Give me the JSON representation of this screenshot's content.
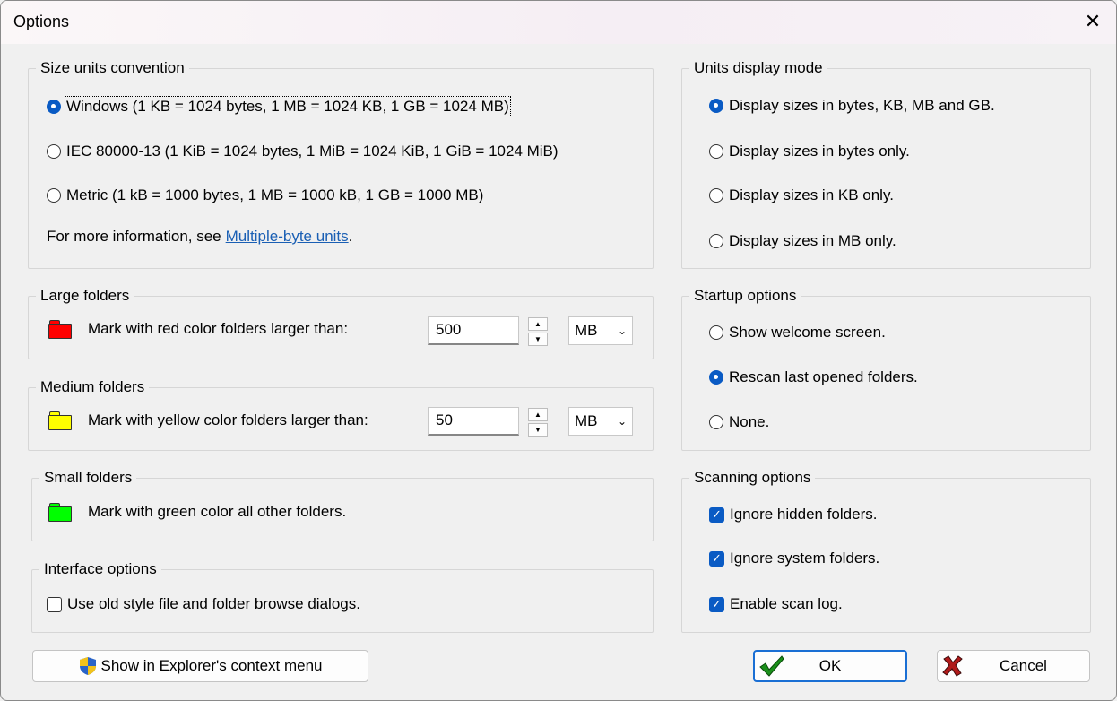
{
  "window": {
    "title": "Options",
    "close_glyph": "✕"
  },
  "size_units": {
    "title": "Size units convention",
    "opt_windows": "Windows (1 KB = 1024 bytes, 1 MB = 1024 KB, 1 GB = 1024 MB)",
    "opt_iec": "IEC 80000-13 (1 KiB = 1024 bytes, 1 MiB = 1024 KiB, 1 GiB = 1024 MiB)",
    "opt_metric": "Metric (1 kB = 1000 bytes, 1 MB = 1000 kB, 1 GB = 1000 MB)",
    "info_prefix": "For more information, see ",
    "info_link": "Multiple-byte units",
    "info_suffix": "."
  },
  "large_folders": {
    "title": "Large folders",
    "label": "Mark with red color folders larger than:",
    "value": "500",
    "unit": "MB",
    "color": "#ff0000"
  },
  "medium_folders": {
    "title": "Medium folders",
    "label": "Mark with yellow color folders larger than:",
    "value": "50",
    "unit": "MB",
    "color": "#ffff00"
  },
  "small_folders": {
    "title": "Small folders",
    "label": "Mark with green color all other folders.",
    "color": "#00ff00"
  },
  "interface_options": {
    "title": "Interface options",
    "old_dialogs": "Use old style file and folder browse dialogs."
  },
  "units_display": {
    "title": "Units display mode",
    "opt_all": "Display sizes in bytes, KB, MB and GB.",
    "opt_bytes": "Display sizes in bytes only.",
    "opt_kb": "Display sizes in KB only.",
    "opt_mb": "Display sizes in MB only."
  },
  "startup": {
    "title": "Startup options",
    "opt_welcome": "Show welcome screen.",
    "opt_rescan": "Rescan last opened folders.",
    "opt_none": "None."
  },
  "scanning": {
    "title": "Scanning options",
    "ignore_hidden": "Ignore hidden folders.",
    "ignore_system": "Ignore system folders.",
    "scan_log": "Enable scan log."
  },
  "buttons": {
    "explorer": "Show in Explorer's context menu",
    "ok": "OK",
    "cancel": "Cancel"
  },
  "colors": {
    "accent": "#0a5bc4",
    "link": "#1a5fb4"
  }
}
